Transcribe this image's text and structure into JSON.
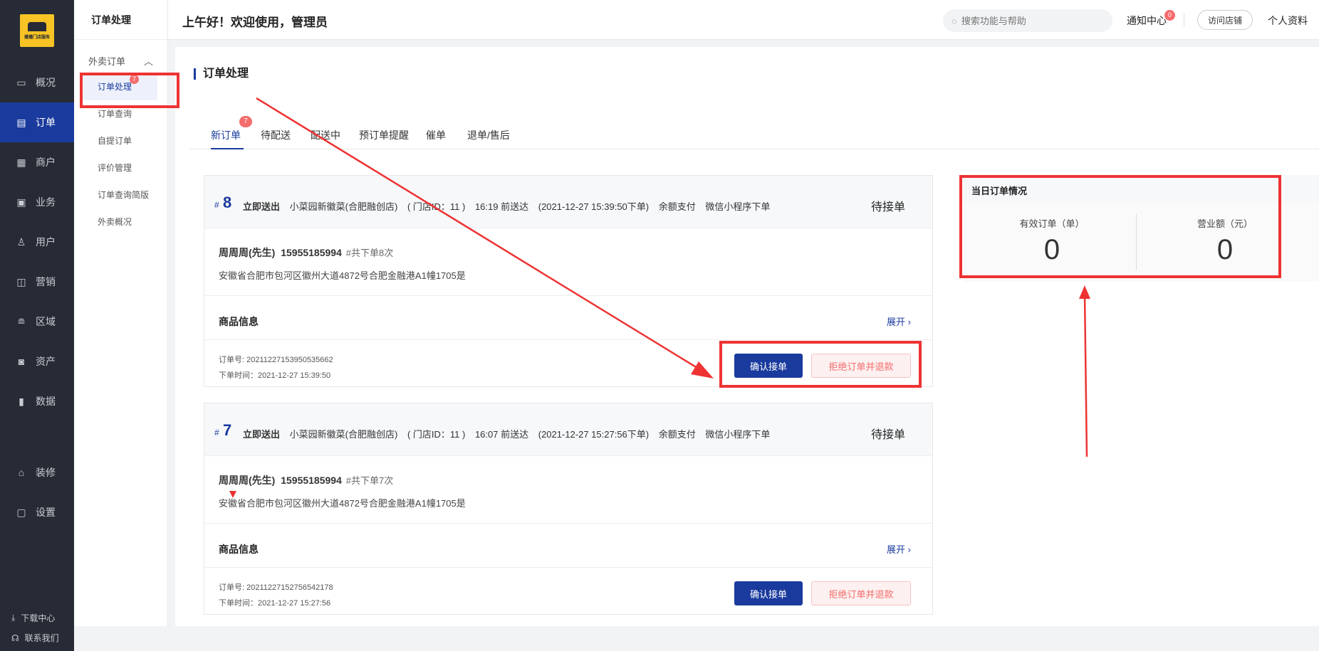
{
  "sidebar": {
    "logo_brand": "播播门店服务",
    "items": [
      {
        "label": "概况",
        "icon": "presentation-icon"
      },
      {
        "label": "订单",
        "icon": "document-icon"
      },
      {
        "label": "商户",
        "icon": "store-icon"
      },
      {
        "label": "业务",
        "icon": "briefcase-icon"
      },
      {
        "label": "用户",
        "icon": "user-icon"
      },
      {
        "label": "营销",
        "icon": "marketing-icon"
      },
      {
        "label": "区域",
        "icon": "database-icon"
      },
      {
        "label": "资产",
        "icon": "wallet-icon"
      },
      {
        "label": "数据",
        "icon": "bar-chart-icon"
      }
    ],
    "bottom_items": [
      {
        "label": "装修",
        "icon": "decorate-icon"
      },
      {
        "label": "设置",
        "icon": "settings-icon"
      }
    ],
    "download": "下载中心",
    "contact": "联系我们"
  },
  "subbar": {
    "title": "订单处理",
    "group": "外卖订单",
    "items": [
      "订单处理",
      "订单查询",
      "自提订单",
      "评价管理",
      "订单查询简版",
      "外卖概况"
    ],
    "active_badge": "7"
  },
  "header": {
    "greeting": "上午好！欢迎使用，管理员",
    "search_placeholder": "搜索功能与帮助",
    "notice": "通知中心",
    "notice_count": "0",
    "visit_store": "访问店铺",
    "profile": "个人资料"
  },
  "page": {
    "title": "订单处理",
    "tabs": [
      "新订单",
      "待配送",
      "配送中",
      "预订单提醒",
      "催单",
      "退单/售后"
    ],
    "new_badge": "7"
  },
  "orders": [
    {
      "hash": "#",
      "num": "8",
      "delivery": "立即送出",
      "store": "小菜园新徽菜(合肥融创店)",
      "store_id": "( 门店ID：11 )",
      "deliver_by": "16:19 前送达",
      "placed": "(2021-12-27 15:39:50下单)",
      "pay": "余额支付",
      "channel": "微信小程序下单",
      "status": "待接单",
      "name": "周周周(先生)",
      "phone": "15955185994",
      "count": "#共下单8次",
      "address": "安徽省合肥市包河区徽州大道4872号合肥金融港A1幢1705是",
      "goods_label": "商品信息",
      "expand": "展开",
      "order_no": "订单号: 20211227153950535662",
      "order_time": "下单时间：2021-12-27 15:39:50",
      "confirm": "确认接单",
      "refuse": "拒绝订单并退款"
    },
    {
      "hash": "#",
      "num": "7",
      "delivery": "立即送出",
      "store": "小菜园新徽菜(合肥融创店)",
      "store_id": "( 门店ID：11 )",
      "deliver_by": "16:07 前送达",
      "placed": "(2021-12-27 15:27:56下单)",
      "pay": "余额支付",
      "channel": "微信小程序下单",
      "status": "待接单",
      "name": "周周周(先生)",
      "phone": "15955185994",
      "count": "#共下单7次",
      "address": "安徽省合肥市包河区徽州大道4872号合肥金融港A1幢1705是",
      "goods_label": "商品信息",
      "expand": "展开",
      "order_no": "订单号: 20211227152756542178",
      "order_time": "下单时间：2021-12-27 15:27:56",
      "confirm": "确认接单",
      "refuse": "拒绝订单并退款"
    }
  ],
  "stats": {
    "title": "当日订单情况",
    "valid_label": "有效订单（单）",
    "valid_value": "0",
    "revenue_label": "营业额（元）",
    "revenue_value": "0"
  },
  "colors": {
    "primary": "#1a3b9d",
    "sidebar_bg": "#262b35",
    "annotation": "#ee3333",
    "badge": "#f56c6c"
  }
}
